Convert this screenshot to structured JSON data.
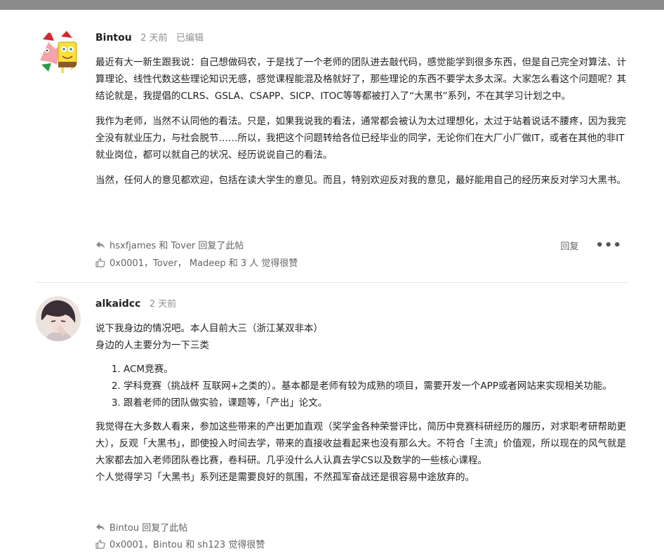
{
  "posts": [
    {
      "username": "Bintou",
      "time": "2 天前",
      "edited": "已编辑",
      "paragraphs": [
        "最近有大一新生跟我说：自己想做码农，于是找了一个老师的团队进去敲代码，感觉能学到很多东西，但是自己完全对算法、计算理论、线性代数这些理论知识无感，感觉课程能混及格就好了，那些理论的东西不要学太多太深。大家怎么看这个问题呢？其结论就是，我提倡的CLRS、GSLA、CSAPP、SICP、ITOC等等都被打入了“大黑书”系列，不在其学习计划之中。",
        "我作为老师，当然不认同他的看法。只是，如果我说我的看法，通常都会被认为太过理想化，太过于站着说话不腰疼，因为我完全没有就业压力，与社会脱节……所以，我把这个问题转给各位已经毕业的同学，无论你们在大厂小厂做IT，或者在其他的非IT就业岗位，都可以就自己的状况、经历说说自己的看法。",
        "当然，任何人的意见都欢迎，包括在读大学生的意见。而且，特别欢迎反对我的意见，最好能用自己的经历来反对学习大黑书。"
      ],
      "reply_info": "hsxfjames 和 Tover 回复了此帖",
      "reply_label": "回复",
      "more_label": "•••",
      "likes": "0x0001，Tover， Madeep 和 3 人 觉得很赞"
    },
    {
      "username": "alkaidcc",
      "time": "2 天前",
      "intro_lines": [
        "说下我身边的情况吧。本人目前大三（浙江某双非本）",
        "身边的人主要分为一下三类"
      ],
      "list": [
        "ACM竞赛。",
        "学科竞赛（挑战杯 互联网+之类的）。基本都是老师有较为成熟的项目，需要开发一个APP或者网站来实现相关功能。",
        "跟着老师的团队做实验，课题等，「产出」论文。"
      ],
      "outro_paragraph": "我觉得在大多数人看来，参加这些带来的产出更加直观（奖学金各种荣誉评比，简历中竞赛科研经历的履历，对求职考研帮助更大），反观「大黑书」，即使投入时间去学，带来的直接收益看起来也没有那么大。不符合「主流」价值观，所以现在的风气就是大家都去加入老师团队卷比赛，卷科研。几乎没什么人认真去学CS以及数学的一些核心课程。",
      "outro_last": "个人觉得学习「大黑书」系列还是需要良好的氛围，不然孤军奋战还是很容易中途放弃的。",
      "reply_info": "Bintou 回复了此帖",
      "likes": "0x0001，Bintou 和 sh123 觉得很赞"
    }
  ],
  "icons": {
    "reply": "reply-arrow-icon",
    "like": "thumbs-up-icon",
    "more": "ellipsis-icon"
  },
  "colors": {
    "muted": "#919191",
    "text": "#222222",
    "topbar": "#8a8a8a"
  }
}
